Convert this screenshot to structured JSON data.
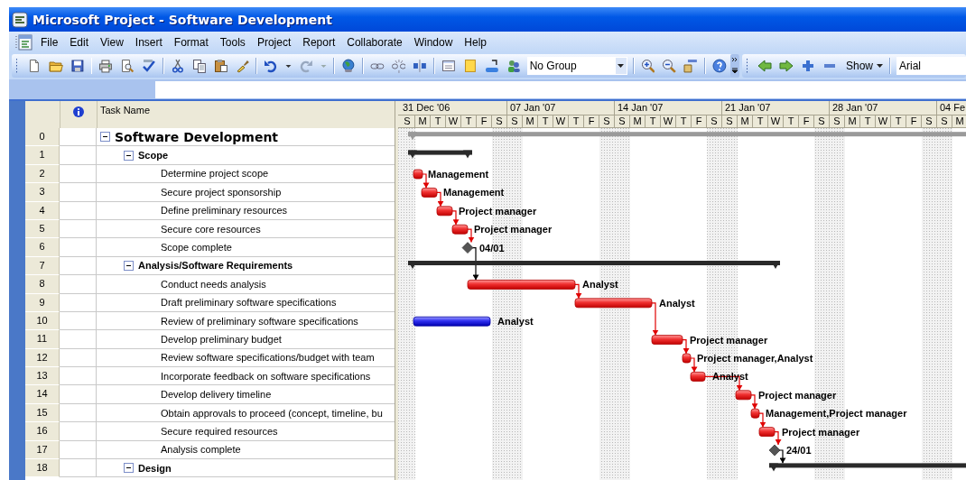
{
  "window": {
    "title": "Microsoft Project - Software Development"
  },
  "menu": [
    "File",
    "Edit",
    "View",
    "Insert",
    "Format",
    "Tools",
    "Project",
    "Report",
    "Collaborate",
    "Window",
    "Help"
  ],
  "toolbar": {
    "group_dropdown": "No Group",
    "show_button": "Show",
    "font_field": "Arial"
  },
  "timescale": {
    "weeks": [
      {
        "label": "31 Dec '06",
        "days": [
          "S",
          "M",
          "T",
          "W",
          "T",
          "F",
          "S"
        ]
      },
      {
        "label": "07 Jan '07",
        "days": [
          "S",
          "M",
          "T",
          "W",
          "T",
          "F",
          "S"
        ]
      },
      {
        "label": "14 Jan '07",
        "days": [
          "S",
          "M",
          "T",
          "W",
          "T",
          "F",
          "S"
        ]
      },
      {
        "label": "21 Jan '07",
        "days": [
          "S",
          "M",
          "T",
          "W",
          "T",
          "F",
          "S"
        ]
      },
      {
        "label": "28 Jan '07",
        "days": [
          "S",
          "M",
          "T",
          "W",
          "T",
          "F",
          "S"
        ]
      },
      {
        "label": "04 Fe",
        "days": [
          "S",
          "M"
        ]
      }
    ]
  },
  "table": {
    "task_name_header": "Task Name",
    "tasks": [
      {
        "row": "0",
        "name": "Software Development",
        "kind": "project",
        "expanded": true,
        "children": [
          {
            "row": "1",
            "name": "Scope",
            "kind": "summary",
            "expanded": true,
            "children": [
              {
                "row": "2",
                "name": "Determine project scope",
                "kind": "task",
                "critical": true,
                "resource_label": "Management"
              },
              {
                "row": "3",
                "name": "Secure project sponsorship",
                "kind": "task",
                "critical": true,
                "resource_label": "Management"
              },
              {
                "row": "4",
                "name": "Define preliminary resources",
                "kind": "task",
                "critical": true,
                "resource_label": "Project manager"
              },
              {
                "row": "5",
                "name": "Secure core resources",
                "kind": "task",
                "critical": true,
                "resource_label": "Project manager"
              },
              {
                "row": "6",
                "name": "Scope complete",
                "kind": "milestone",
                "date_label": "04/01"
              }
            ]
          },
          {
            "row": "7",
            "name": "Analysis/Software Requirements",
            "kind": "summary",
            "expanded": true,
            "children": [
              {
                "row": "8",
                "name": "Conduct needs analysis",
                "kind": "task",
                "critical": true,
                "resource_label": "Analyst"
              },
              {
                "row": "9",
                "name": "Draft preliminary software specifications",
                "kind": "task",
                "critical": true,
                "resource_label": "Analyst"
              },
              {
                "row": "10",
                "name": "Review of preliminary software specifications",
                "kind": "task",
                "critical": false,
                "resource_label": "Analyst"
              },
              {
                "row": "11",
                "name": "Develop preliminary budget",
                "kind": "task",
                "critical": true,
                "resource_label": "Project manager"
              },
              {
                "row": "12",
                "name": "Review software specifications/budget with team",
                "kind": "task",
                "critical": true,
                "resource_label": "Project manager,Analyst"
              },
              {
                "row": "13",
                "name": "Incorporate feedback on software specifications",
                "kind": "task",
                "critical": true,
                "resource_label": "Analyst"
              },
              {
                "row": "14",
                "name": "Develop delivery timeline",
                "kind": "task",
                "critical": true,
                "resource_label": "Project manager"
              },
              {
                "row": "15",
                "name": "Obtain approvals to proceed (concept, timeline, bu",
                "kind": "task",
                "critical": true,
                "resource_label": "Management,Project manager"
              },
              {
                "row": "16",
                "name": "Secure required resources",
                "kind": "task",
                "critical": true,
                "resource_label": "Project manager"
              },
              {
                "row": "17",
                "name": "Analysis complete",
                "kind": "milestone",
                "date_label": "24/01"
              }
            ]
          },
          {
            "row": "18",
            "name": "Design",
            "kind": "summary",
            "expanded": true
          }
        ]
      }
    ]
  }
}
